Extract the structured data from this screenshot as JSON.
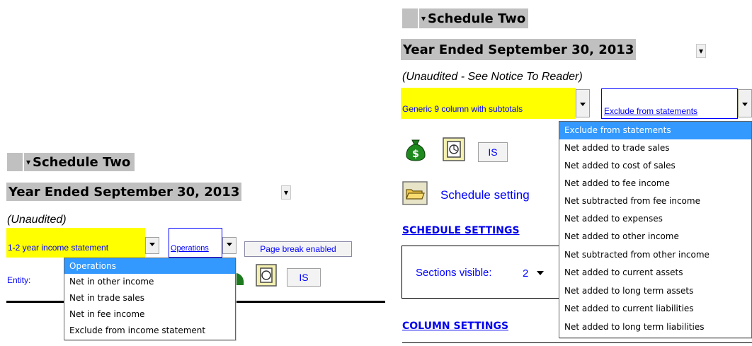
{
  "left": {
    "title": "Schedule Two",
    "year_title": "Year Ended September 30, 2013",
    "unaudited": "(Unaudited)",
    "statement_select": "1-2 year income statement",
    "class_select": "Operations",
    "page_break_button": "Page break enabled",
    "entity_label": "Entity:",
    "is_button": "IS",
    "dropdown_items": [
      "Operations",
      "Net in other income",
      "Net in trade sales",
      "Net in fee income",
      "Exclude from income statement"
    ]
  },
  "right": {
    "title": "Schedule Two",
    "year_title": "Year Ended September 30, 2013",
    "notice": "(Unaudited - See Notice To Reader)",
    "statement_select": "Generic 9 column with subtotals",
    "class_select": "Exclude from statements",
    "is_button": "IS",
    "schedule_settings_button": "Schedule setting",
    "schedule_settings_heading": "SCHEDULE SETTINGS",
    "sections_visible_label": "Sections visible:",
    "sections_visible_value": "2",
    "column_settings_heading": "COLUMN SETTINGS",
    "dropdown_items": [
      "Exclude from statements",
      "Net added to trade sales",
      "Net added to cost of sales",
      "Net added to fee income",
      "Net subtracted from fee income",
      "Net added to expenses",
      "Net added to other income",
      "Net subtracted from other income",
      "Net added to current assets",
      "Net added to long term assets",
      "Net added to current liabilities",
      "Net added to long term liabilities"
    ]
  },
  "colors": {
    "highlight_yellow": "#ffff00",
    "title_gray": "#c0c0c0",
    "link_blue": "#0000ff",
    "selected_blue": "#3399ff"
  }
}
